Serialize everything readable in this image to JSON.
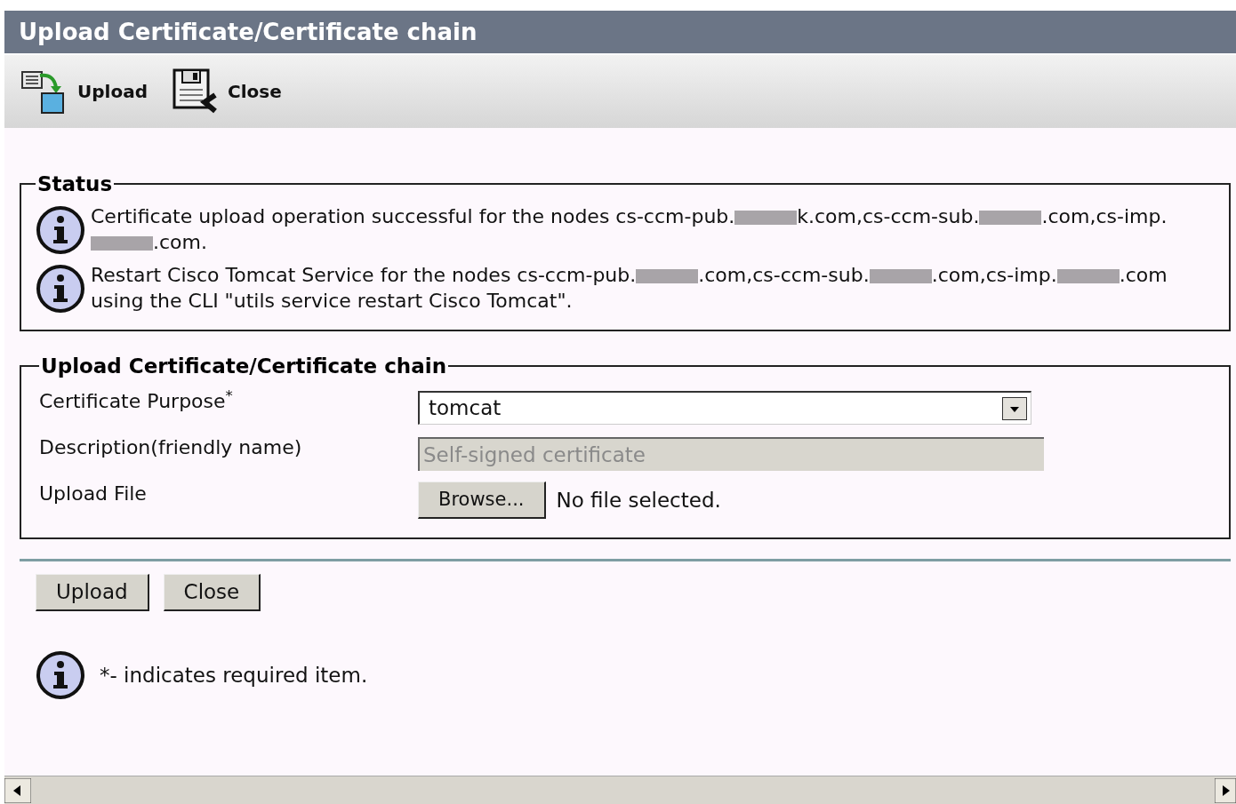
{
  "window": {
    "title": "Upload Certificate/Certificate chain"
  },
  "toolbar": [
    {
      "kind": "upload",
      "label": "Upload"
    },
    {
      "kind": "close",
      "label": "Close"
    }
  ],
  "status": {
    "legend": "Status",
    "messages": [
      {
        "parts": [
          "Certificate upload operation successful for the nodes cs-ccm-pub.",
          "k.com,cs-ccm-sub.",
          ".com,cs-imp.",
          ".com."
        ]
      },
      {
        "parts": [
          "Restart Cisco Tomcat Service for the nodes cs-ccm-pub.",
          ".com,cs-ccm-sub.",
          ".com,cs-imp.",
          ".com using the CLI \"utils service restart Cisco Tomcat\"."
        ]
      }
    ]
  },
  "form": {
    "legend": "Upload Certificate/Certificate chain",
    "fields": [
      {
        "kind": "select",
        "label": "Certificate Purpose$^{*}$",
        "value": "tomcat"
      },
      {
        "kind": "text",
        "label": "Description(friendly name)",
        "value": "Self-signed certificate",
        "disabled": true
      },
      {
        "kind": "file",
        "label": "Upload File",
        "button": "Browse...",
        "file_status": "No file selected."
      }
    ]
  },
  "buttons": [
    "Upload",
    "Close"
  ],
  "note": "*- indicates required item."
}
